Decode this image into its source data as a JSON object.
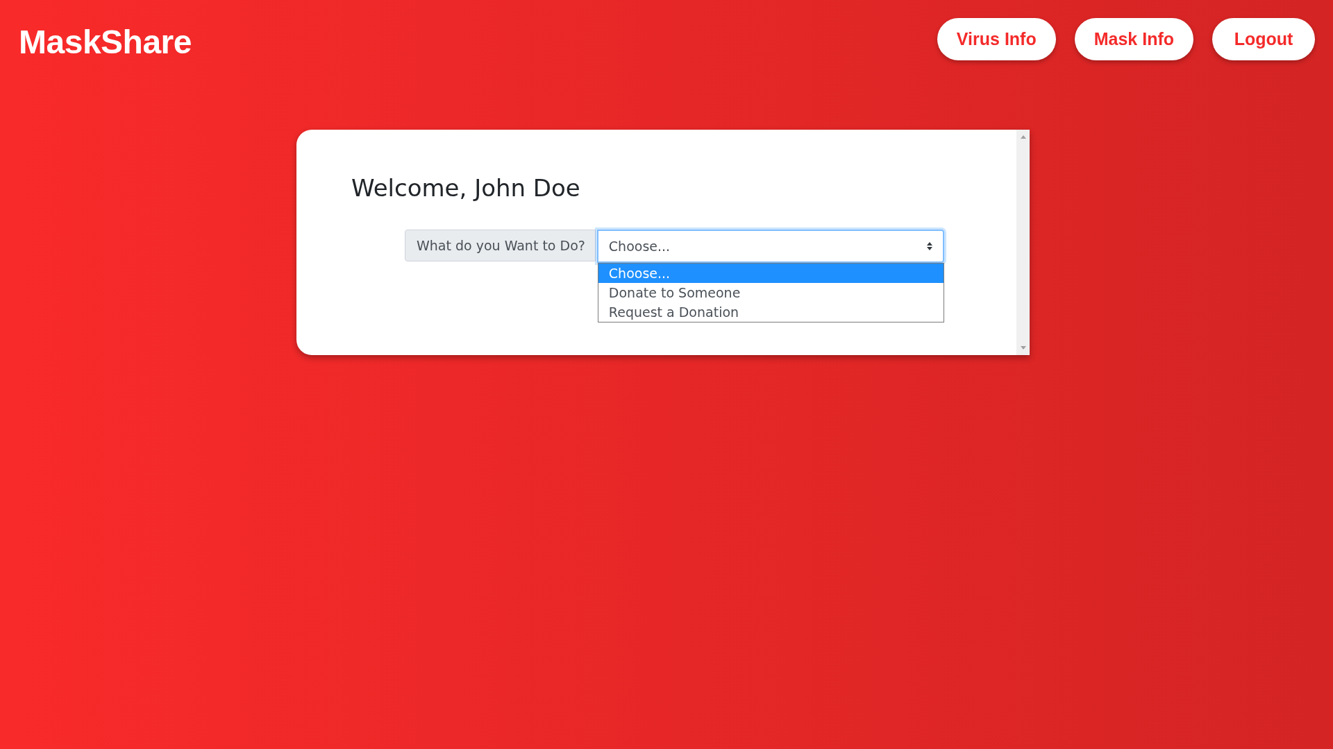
{
  "brand": "MaskShare",
  "nav": [
    "Virus Info",
    "Mask Info",
    "Logout"
  ],
  "card": {
    "heading": "Welcome, John Doe",
    "field_label": "What do you Want to Do?",
    "select": {
      "value": "Choose...",
      "expanded": true,
      "options": [
        {
          "label": "Choose...",
          "selected": true
        },
        {
          "label": "Donate to Someone",
          "selected": false
        },
        {
          "label": "Request a Donation",
          "selected": false
        }
      ]
    }
  }
}
